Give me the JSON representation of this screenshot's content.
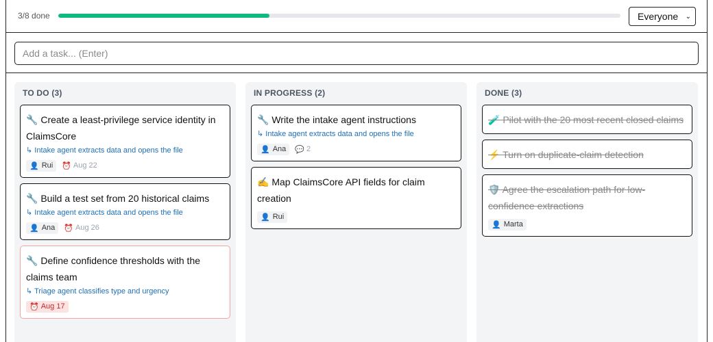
{
  "progress": {
    "label": "3/8 done",
    "fraction": 0.375
  },
  "filter": {
    "selected": "Everyone"
  },
  "add_task": {
    "placeholder": "Add a task... (Enter)"
  },
  "colors": {
    "accent": "#10b981",
    "link": "#1d6fb8",
    "overdue": "#c62828"
  },
  "columns": [
    {
      "header": "TO DO (3)",
      "cards": [
        {
          "icon": "🔧",
          "title": "Create a least-privilege service identity in ClaimsCore",
          "parent": "↳ Intake agent extracts data and opens the file",
          "assignee": "Rui",
          "due": "Aug 22"
        },
        {
          "icon": "🔧",
          "title": "Build a test set from 20 historical claims",
          "parent": "↳ Intake agent extracts data and opens the file",
          "assignee": "Ana",
          "due": "Aug 26"
        },
        {
          "icon": "🔧",
          "title": "Define confidence thresholds with the claims team",
          "parent": "↳ Triage agent classifies type and urgency",
          "due": "Aug 17"
        }
      ]
    },
    {
      "header": "IN PROGRESS (2)",
      "cards": [
        {
          "icon": "🔧",
          "title": "Write the intake agent instructions",
          "parent": "↳ Intake agent extracts data and opens the file",
          "assignee": "Ana",
          "comments": "2"
        },
        {
          "icon": "✍️",
          "title": "Map ClaimsCore API fields for claim creation",
          "assignee": "Rui"
        }
      ]
    },
    {
      "header": "DONE (3)",
      "cards": [
        {
          "icon": "🧪",
          "title": "Pilot with the 20 most recent closed claims"
        },
        {
          "icon": "⚡",
          "title": "Turn on duplicate-claim detection"
        },
        {
          "icon": "🛡️",
          "title": "Agree the escalation path for low-confidence extractions",
          "assignee": "Marta"
        }
      ]
    }
  ]
}
